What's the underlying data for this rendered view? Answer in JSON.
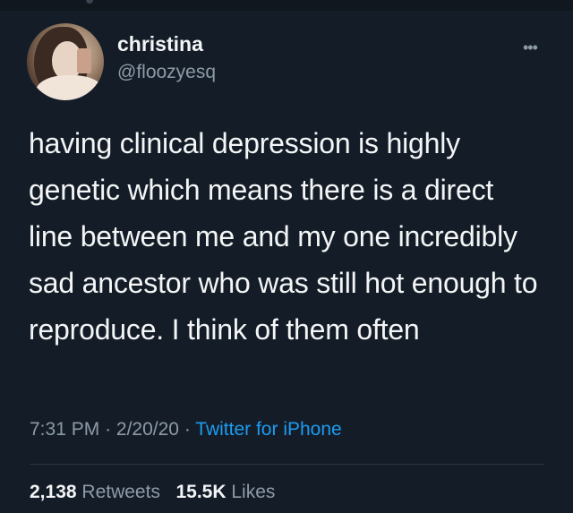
{
  "tweet": {
    "display_name": "christina",
    "handle": "@floozyesq",
    "text": "having clinical depression is highly genetic which means there is a direct line between me and my one incredibly sad ancestor who was still hot enough to reproduce. I think of them often",
    "time": "7:31 PM",
    "separator": "·",
    "date": "2/20/20",
    "source": "Twitter for iPhone",
    "retweets_count": "2,138",
    "retweets_label": "Retweets",
    "likes_count": "15.5K",
    "likes_label": "Likes"
  },
  "icons": {
    "more": "more-icon",
    "avatar": "profile-avatar"
  },
  "colors": {
    "background": "#141d27",
    "text": "#f3f5f6",
    "muted": "#8d9aa8",
    "link": "#1d9bf0"
  }
}
